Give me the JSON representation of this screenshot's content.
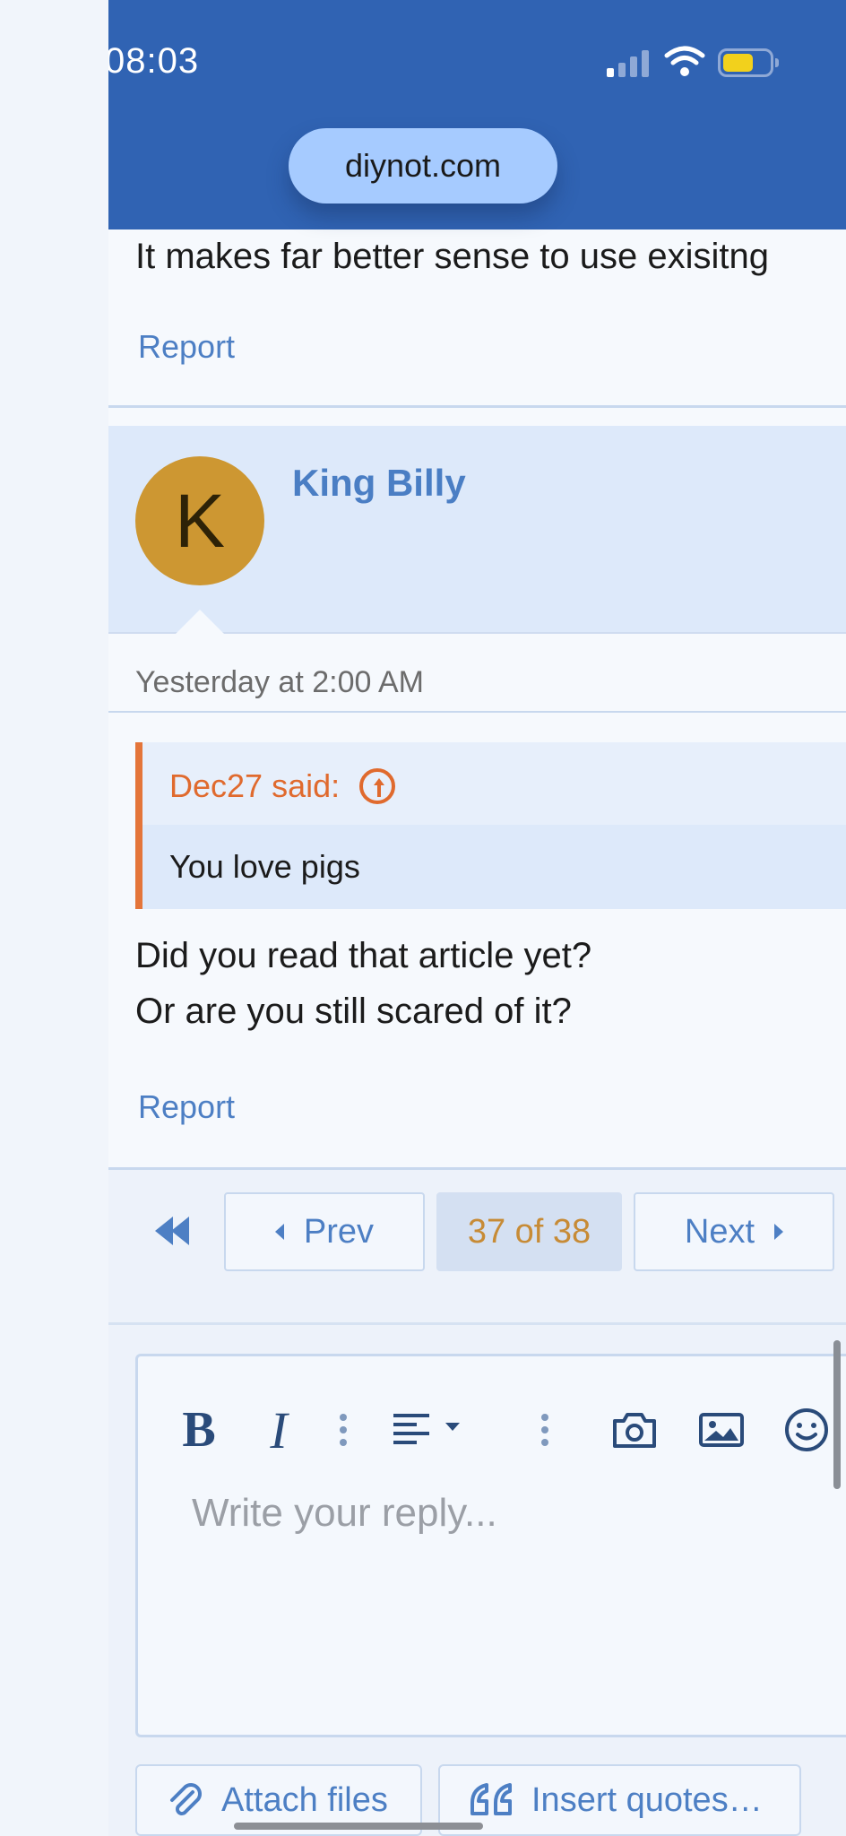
{
  "status_bar": {
    "time": "08:03"
  },
  "browser": {
    "url": "diynot.com"
  },
  "previous_post": {
    "text": "It makes far better sense to use exisitng",
    "report_label": "Report"
  },
  "post": {
    "author": {
      "name": "King Billy",
      "avatar_initial": "K",
      "avatar_color": "#cd9732"
    },
    "date": "Yesterday at 2:00 AM",
    "quote": {
      "attribution": "Dec27 said:",
      "text": "You love pigs"
    },
    "body": [
      "Did you read that article yet?",
      "Or are you still scared of it?"
    ],
    "report_label": "Report"
  },
  "pagination": {
    "prev_label": "Prev",
    "current": "37 of 38",
    "next_label": "Next"
  },
  "editor": {
    "toolbar": {
      "bold": "B",
      "italic": "I",
      "align": "align-icon",
      "camera": "camera-icon",
      "image": "image-icon",
      "emoji": "emoji-icon"
    },
    "placeholder": "Write your reply...",
    "attach_label": "Attach files",
    "insert_quotes_label": "Insert quotes…"
  },
  "colors": {
    "header_blue": "#3063b3",
    "link_blue": "#4d7fc4",
    "quote_accent": "#e4753a",
    "page_indicator": "#c78b36"
  }
}
